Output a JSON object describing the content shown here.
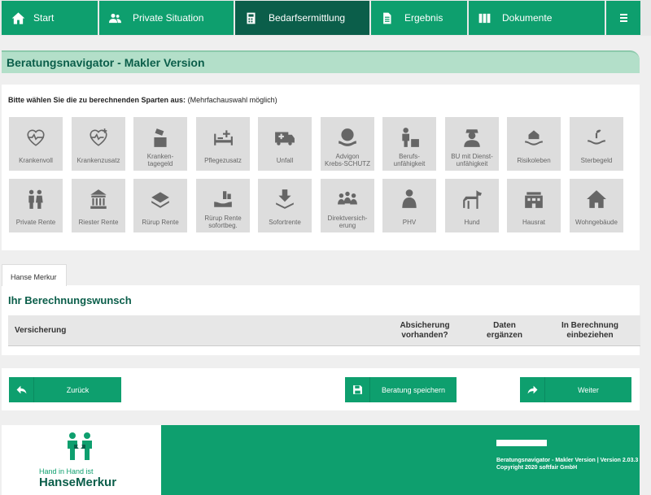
{
  "nav": {
    "items": [
      {
        "label": "Start",
        "icon": "home-icon"
      },
      {
        "label": "Private Situation",
        "icon": "users-icon"
      },
      {
        "label": "Bedarfsermittlung",
        "icon": "calculator-icon"
      },
      {
        "label": "Ergebnis",
        "icon": "document-icon"
      },
      {
        "label": "Dokumente",
        "icon": "folders-icon"
      }
    ],
    "menu_icon": "hamburger-icon"
  },
  "page_title": "Beratungsnavigator - Makler Version",
  "selection": {
    "prompt_bold": "Bitte wählen Sie die zu berechnenden Sparten aus:",
    "prompt_note": "(Mehrfachauswahl möglich)",
    "tiles": [
      {
        "label": "Krankenvoll",
        "icon": "heart-pulse-icon"
      },
      {
        "label": "Krankenzusatz",
        "icon": "heart-plus-icon"
      },
      {
        "label": "Kranken-\ntagegeld",
        "icon": "hand-coin-icon"
      },
      {
        "label": "Pflegezusatz",
        "icon": "bed-plus-icon"
      },
      {
        "label": "Unfall",
        "icon": "ambulance-icon"
      },
      {
        "label": "Advigon\nKrebs-SCHUTZ",
        "icon": "shield-hands-icon"
      },
      {
        "label": "Berufs-\nunfähigkeit",
        "icon": "worker-icon"
      },
      {
        "label": "BU mit Dienst-\nunfähigkeit",
        "icon": "officer-icon"
      },
      {
        "label": "Risikoleben",
        "icon": "house-hand-icon"
      },
      {
        "label": "Sterbegeld",
        "icon": "hand-plant-icon"
      },
      {
        "label": "Private Rente",
        "icon": "elderly-couple-icon"
      },
      {
        "label": "Riester Rente",
        "icon": "government-building-icon"
      },
      {
        "label": "Rürup Rente",
        "icon": "money-stack-icon"
      },
      {
        "label": "Rürup Rente\nsofortbeg.",
        "icon": "hand-coins-icon"
      },
      {
        "label": "Sofortrente",
        "icon": "money-download-icon"
      },
      {
        "label": "Direktversich-\nerung",
        "icon": "team-icon"
      },
      {
        "label": "PHV",
        "icon": "person-icon"
      },
      {
        "label": "Hund",
        "icon": "dog-icon"
      },
      {
        "label": "Hausrat",
        "icon": "building-icon"
      },
      {
        "label": "Wohngebäude",
        "icon": "house-icon"
      }
    ]
  },
  "tab": {
    "label": "Hanse Merkur"
  },
  "wish": {
    "title": "Ihr Berechnungswunsch",
    "columns": [
      {
        "label": "Versicherung"
      },
      {
        "label": "Absicherung\nvorhanden?"
      },
      {
        "label": "Daten\nergänzen"
      },
      {
        "label": "In Berechnung\neinbeziehen"
      }
    ]
  },
  "buttons": {
    "back": {
      "label": "Zurück",
      "icon": "arrow-left-icon"
    },
    "save": {
      "label": "Beratung speichern",
      "icon": "save-icon"
    },
    "next": {
      "label": "Weiter",
      "icon": "arrow-right-icon"
    }
  },
  "footer": {
    "logo_line1": "Hand in Hand ist",
    "logo_line2": "HanseMerkur",
    "version": "Beratungsnavigator - Makler Version | Version 2.03.3",
    "copyright": "Copyright 2020 softfair GmbH"
  },
  "colors": {
    "primary": "#0e9f6e",
    "dark": "#0b5e4a",
    "title_bg": "#b3dfc9",
    "tile_bg": "#dddddd"
  }
}
